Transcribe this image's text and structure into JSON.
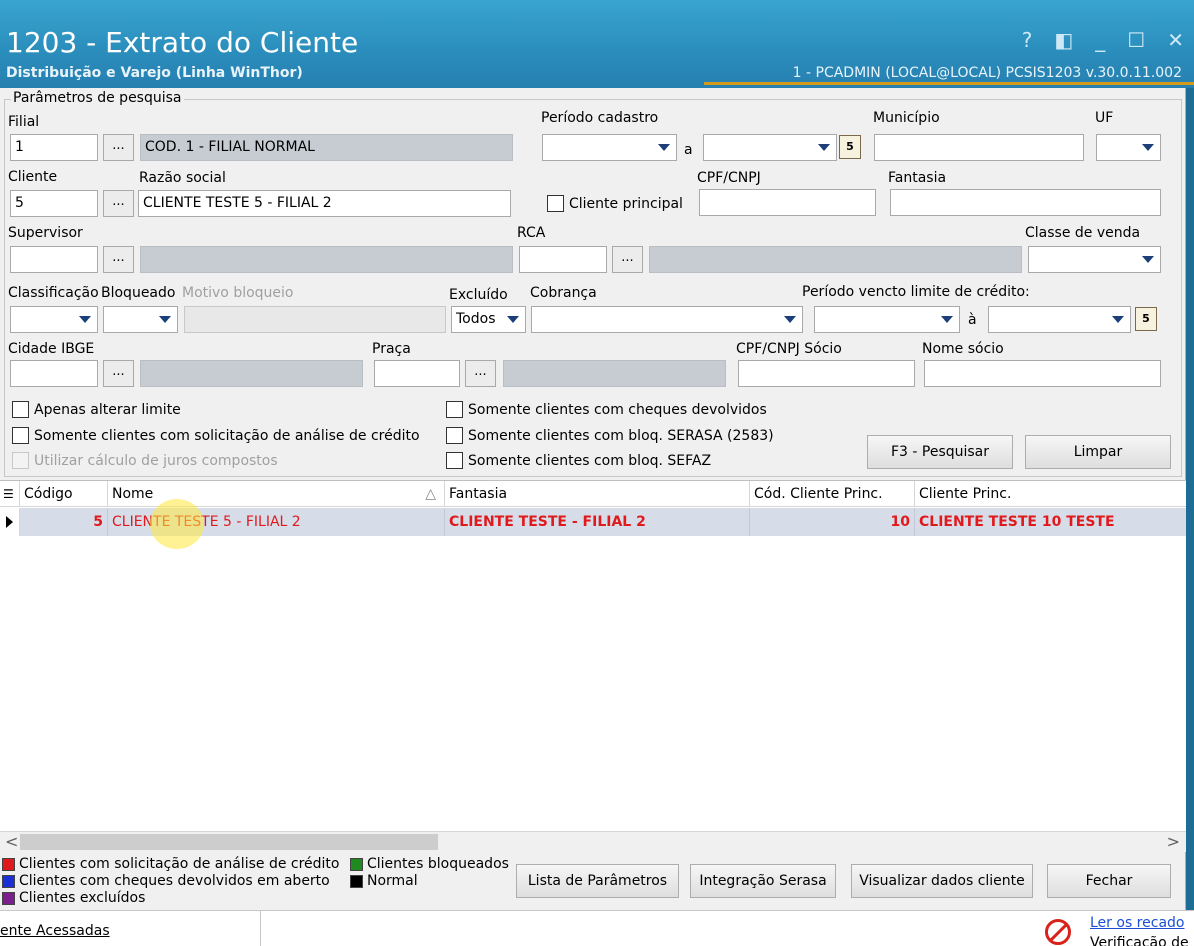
{
  "window": {
    "title": "1203 - Extrato do Cliente",
    "subtitle": "Distribuição e Varejo (Linha WinThor)",
    "session": "1 - PCADMIN (LOCAL@LOCAL)   PCSIS1203  v.30.0.11.002",
    "controls": {
      "help": "?",
      "restore_alt": "◧",
      "minimize": "_",
      "maximize": "☐",
      "close": "✕"
    }
  },
  "params": {
    "legend": "Parâmetros de pesquisa",
    "filial": {
      "label": "Filial",
      "code": "1",
      "desc": "COD. 1 - FILIAL NORMAL"
    },
    "periodo_cadastro": {
      "label": "Período cadastro",
      "sep": "a"
    },
    "municipio": {
      "label": "Município"
    },
    "uf": {
      "label": "UF"
    },
    "cliente": {
      "label": "Cliente",
      "code": "5"
    },
    "razao_social": {
      "label": "Razão social",
      "value": "CLIENTE TESTE 5  - FILIAL 2"
    },
    "cliente_principal": {
      "label": "Cliente principal"
    },
    "cpf_cnpj": {
      "label": "CPF/CNPJ"
    },
    "fantasia": {
      "label": "Fantasia"
    },
    "supervisor": {
      "label": "Supervisor"
    },
    "rca": {
      "label": "RCA"
    },
    "classe_venda": {
      "label": "Classe de venda"
    },
    "classificacao": {
      "label": "Classificação"
    },
    "bloqueado": {
      "label": "Bloqueado"
    },
    "motivo_bloqueio": {
      "label": "Motivo bloqueio"
    },
    "excluido": {
      "label": "Excluído",
      "value": "Todos"
    },
    "cobranca": {
      "label": "Cobrança"
    },
    "periodo_vencto": {
      "label": "Período vencto limite de crédito:",
      "sep": "à"
    },
    "cidade_ibge": {
      "label": "Cidade IBGE"
    },
    "praca": {
      "label": "Praça"
    },
    "cpf_cnpj_socio": {
      "label": "CPF/CNPJ Sócio"
    },
    "nome_socio": {
      "label": "Nome sócio"
    },
    "ellipsis": "...",
    "calendar_glyph": "5",
    "checks": {
      "apenas_alterar_limite": "Apenas alterar limite",
      "solicitacao_analise": "Somente clientes com solicitação de análise de crédito",
      "juros_compostos": "Utilizar cálculo de juros compostos",
      "cheques_devolvidos": "Somente clientes com cheques devolvidos",
      "bloq_serasa": "Somente clientes com bloq. SERASA (2583)",
      "bloq_sefaz": "Somente clientes com bloq. SEFAZ"
    },
    "buttons": {
      "pesquisar": "F3 - Pesquisar",
      "limpar": "Limpar"
    }
  },
  "grid": {
    "columns": [
      "Código",
      "Nome",
      "Fantasia",
      "Cód. Cliente Princ.",
      "Cliente Princ."
    ],
    "sort_indicator": "△",
    "rows": [
      {
        "codigo": "5",
        "nome": "CLIENTE TESTE 5  - FILIAL 2",
        "fantasia": "CLIENTE TESTE - FILIAL 2",
        "cod_princ": "10",
        "cliente_princ": "CLIENTE TESTE 10 TESTE"
      }
    ],
    "scroll_left": "<",
    "scroll_right": ">"
  },
  "legend": {
    "items": [
      {
        "label": "Clientes com solicitação de análise de crédito",
        "color": "#e0191c"
      },
      {
        "label": "Clientes com cheques devolvidos em aberto",
        "color": "#1a2fd6"
      },
      {
        "label": "Clientes excluídos",
        "color": "#7a1f8c"
      },
      {
        "label": "Clientes bloqueados",
        "color": "#1f8a1f"
      },
      {
        "label": "Normal",
        "color": "#000000"
      }
    ]
  },
  "footer_buttons": {
    "lista_parametros": "Lista de Parâmetros",
    "integracao_serasa": "Integração Serasa",
    "visualizar_dados": "Visualizar dados cliente",
    "fechar": "Fechar"
  },
  "taskbar": {
    "left_link": "ente Acessadas",
    "msg_link": "Ler os recado",
    "msg_sub": "Verificação de"
  }
}
